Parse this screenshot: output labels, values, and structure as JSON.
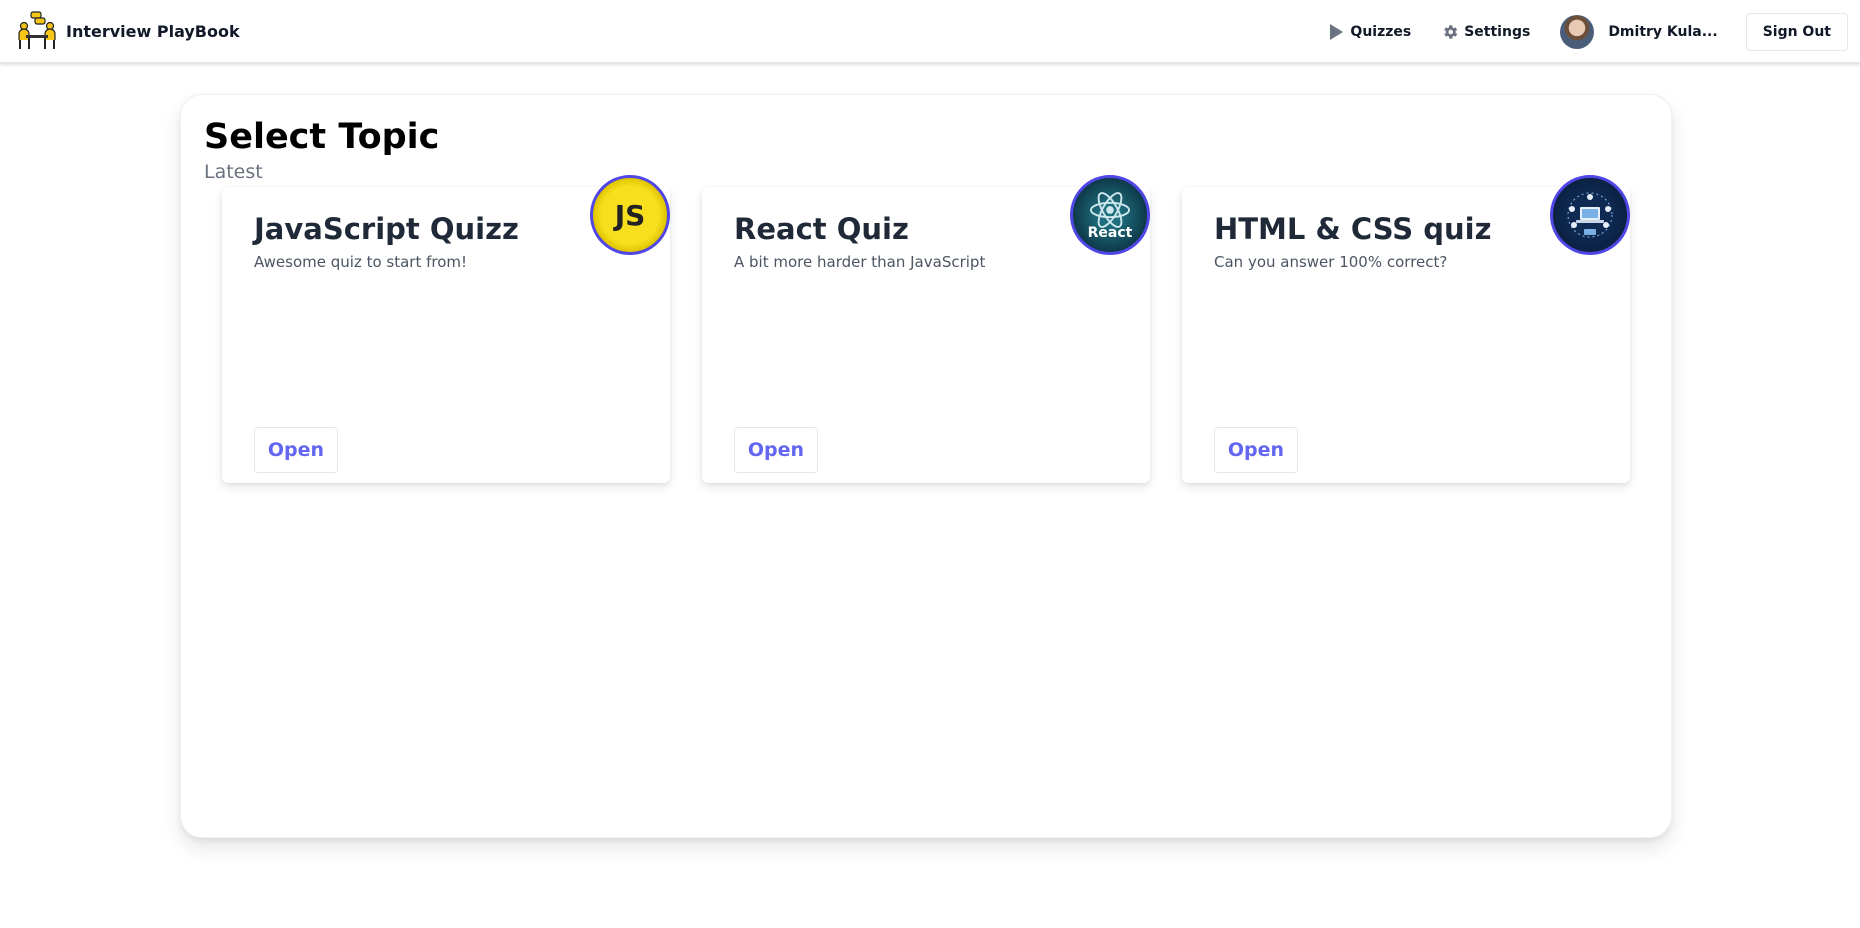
{
  "header": {
    "brand_name": "Interview PlayBook",
    "nav": [
      {
        "label": "Quizzes",
        "icon": "play-icon"
      },
      {
        "label": "Settings",
        "icon": "gear-icon"
      }
    ],
    "user_name": "Dmitry Kula...",
    "signout_label": "Sign Out"
  },
  "main": {
    "title": "Select Topic",
    "section_label": "Latest",
    "cards": [
      {
        "title": "JavaScript Quizz",
        "description": "Awesome quiz to start from!",
        "button_label": "Open",
        "badge_text": "JS"
      },
      {
        "title": "React Quiz",
        "description": "A bit more harder than JavaScript",
        "button_label": "Open",
        "badge_text": "React"
      },
      {
        "title": "HTML & CSS quiz",
        "description": "Can you answer 100% correct?",
        "button_label": "Open",
        "badge_text": ""
      }
    ]
  },
  "colors": {
    "accent": "#6366f1",
    "badge_border": "#4f46e5"
  }
}
